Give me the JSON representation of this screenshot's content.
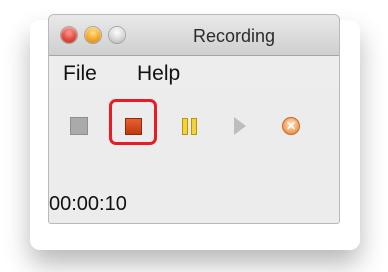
{
  "window": {
    "title": "Recording"
  },
  "menu": {
    "items": [
      "File",
      "Help"
    ]
  },
  "toolbar": {
    "buttons": [
      {
        "name": "record",
        "icon": "record-square-icon",
        "enabled": false
      },
      {
        "name": "stop",
        "icon": "stop-square-icon",
        "highlighted": true
      },
      {
        "name": "pause",
        "icon": "pause-icon"
      },
      {
        "name": "play",
        "icon": "play-arrow-icon",
        "enabled": false
      },
      {
        "name": "cancel",
        "icon": "cancel-circle-icon"
      }
    ],
    "cancel_glyph": "×"
  },
  "status": {
    "elapsed": "00:00:10"
  },
  "colors": {
    "stop": "#d4431a",
    "pause": "#f4d23a",
    "highlight": "#ea1b25",
    "cancel": "#f6a15c"
  }
}
